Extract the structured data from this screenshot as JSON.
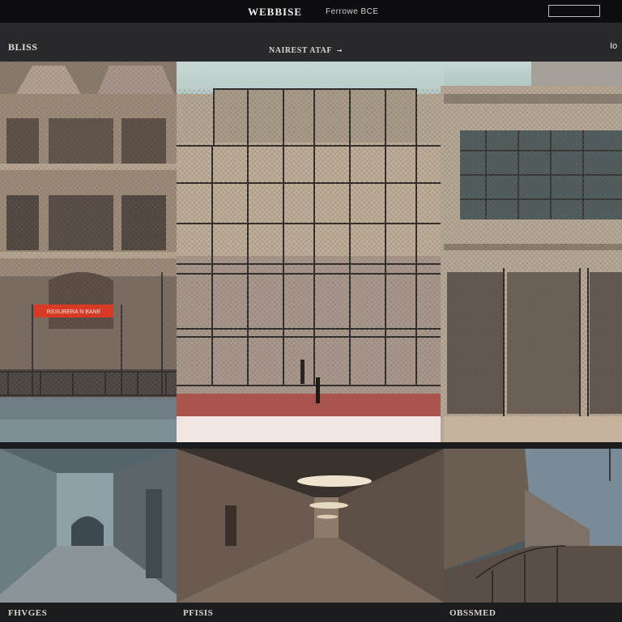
{
  "header": {
    "brand": "WEBBISE",
    "brand_sub": "Ferrowe BCE",
    "search": {
      "placeholder": ""
    }
  },
  "subnav": {
    "logo": "BLISS",
    "menu_link": "NAIREST ATAF",
    "menu_arrow": "→",
    "corner_label": "Io"
  },
  "hero": {
    "sign_text": "RSSURERA N BANE"
  },
  "gallery": {
    "items": [
      {
        "caption": "FHVGES"
      },
      {
        "caption": "PFISIS"
      },
      {
        "caption": "OBSSMED"
      }
    ]
  },
  "colors": {
    "topbar": "#0d0d0f",
    "subbar": "#29292b",
    "sign_red": "#d83a26",
    "sky": "#bcd1cf"
  },
  "icons": [
    "chevron-right-icon"
  ]
}
